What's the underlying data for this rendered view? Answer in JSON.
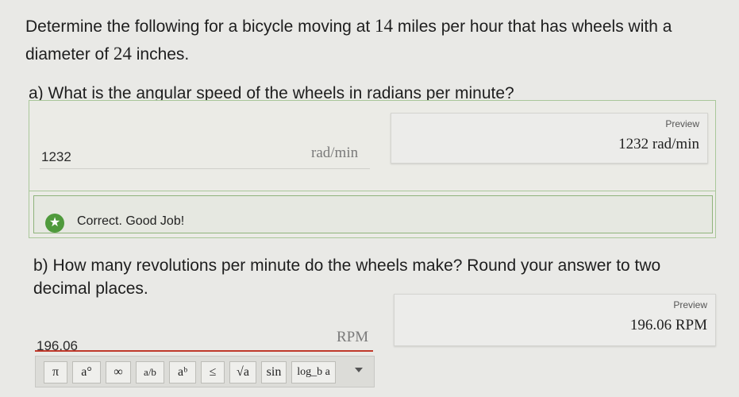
{
  "problem": {
    "p1": "Determine the following for a bicycle moving at ",
    "speed": "14",
    "p2": " miles per hour that has wheels with a diameter of ",
    "diameter": "24",
    "p3": " inches."
  },
  "part_a": {
    "question": "a) What is the angular speed of the wheels in radians per minute?",
    "answer": "1232",
    "unit": "rad/min",
    "preview_label": "Preview",
    "preview_value": "1232 rad/min",
    "feedback": "Correct. Good Job!"
  },
  "part_b": {
    "question": "b) How many revolutions per minute do the wheels make? Round your answer to two decimal places.",
    "answer": "196.06",
    "unit": "RPM",
    "preview_label": "Preview",
    "preview_value": "196.06 RPM"
  },
  "toolbar": {
    "buttons": [
      "π",
      "a°",
      "∞",
      "a/b",
      "aᵇ",
      "≤",
      "√a",
      "sin",
      "log_b a"
    ]
  },
  "colors": {
    "correct_green": "#4f9a3c",
    "active_underline": "#c0392b"
  }
}
